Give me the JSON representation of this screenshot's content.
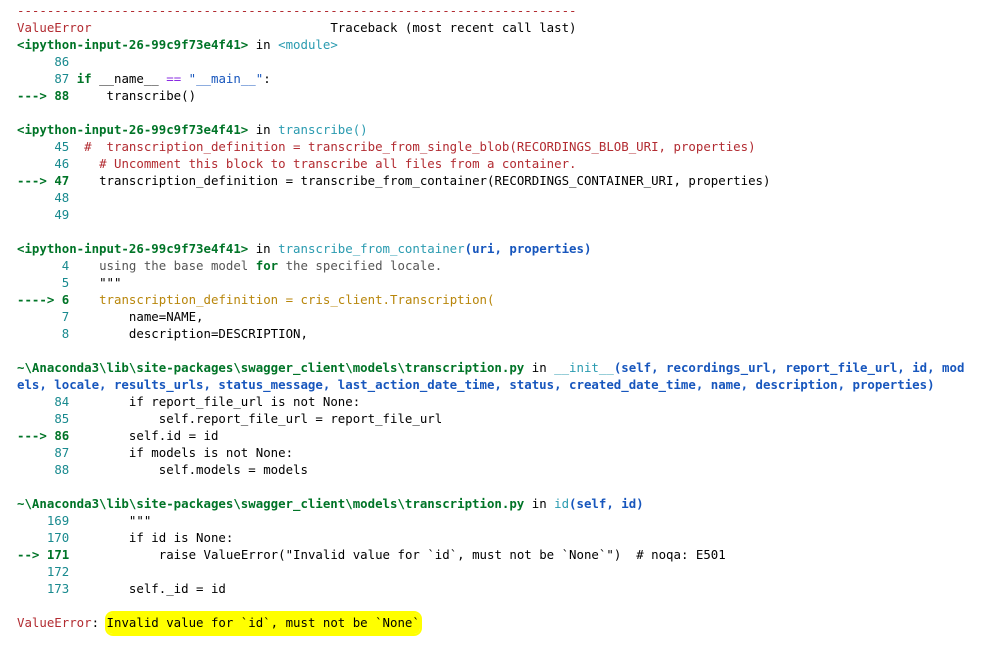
{
  "traceback": {
    "separator": "---------------------------------------------------------------------------",
    "header_error": "ValueError",
    "header_right": "Traceback (most recent call last)",
    "frames": [
      {
        "file": "<ipython-input-26-99c9f73e4f41>",
        "in": " in ",
        "func": "<module>",
        "lines": [
          {
            "arrow": "",
            "num": "86",
            "code": ""
          },
          {
            "arrow": "",
            "num": "87",
            "code": "if __name__ == \"__main__\":"
          },
          {
            "arrow": "--->",
            "num": "88",
            "code": "    transcribe()"
          }
        ]
      },
      {
        "file": "<ipython-input-26-99c9f73e4f41>",
        "in": " in ",
        "func": "transcribe()",
        "lines": [
          {
            "arrow": "",
            "num": "45",
            "code": "#  transcription_definition = transcribe_from_single_blob(RECORDINGS_BLOB_URI, properties)"
          },
          {
            "arrow": "",
            "num": "46",
            "code": "    # Uncomment this block to transcribe all files from a container."
          },
          {
            "arrow": "--->",
            "num": "47",
            "code": "    transcription_definition = transcribe_from_container(RECORDINGS_CONTAINER_URI, properties)"
          },
          {
            "arrow": "",
            "num": "48",
            "code": ""
          },
          {
            "arrow": "",
            "num": "49",
            "code": ""
          }
        ]
      },
      {
        "file": "<ipython-input-26-99c9f73e4f41>",
        "in": " in ",
        "func": "transcribe_from_container",
        "args": "(uri, properties)",
        "lines": [
          {
            "arrow": "",
            "num": "4",
            "code": "    using the base model for the specified locale."
          },
          {
            "arrow": "",
            "num": "5",
            "code": "    \"\"\""
          },
          {
            "arrow": "---->",
            "num": "6",
            "code": "    transcription_definition = cris_client.Transcription("
          },
          {
            "arrow": "",
            "num": "7",
            "code": "        name=NAME,"
          },
          {
            "arrow": "",
            "num": "8",
            "code": "        description=DESCRIPTION,"
          }
        ]
      },
      {
        "file": "~\\Anaconda3\\lib\\site-packages\\swagger_client\\models\\transcription.py",
        "in": " in ",
        "func": "__init__",
        "args_line1": "(self, recordings_url, report_file_url, id, mod",
        "args_line2": "els, locale, results_urls, status_message, last_action_date_time, status, created_date_time, name, description, properties)",
        "lines": [
          {
            "arrow": "",
            "num": "84",
            "code": "        if report_file_url is not None:"
          },
          {
            "arrow": "",
            "num": "85",
            "code": "            self.report_file_url = report_file_url"
          },
          {
            "arrow": "--->",
            "num": "86",
            "code": "        self.id = id"
          },
          {
            "arrow": "",
            "num": "87",
            "code": "        if models is not None:"
          },
          {
            "arrow": "",
            "num": "88",
            "code": "            self.models = models"
          }
        ]
      },
      {
        "file": "~\\Anaconda3\\lib\\site-packages\\swagger_client\\models\\transcription.py",
        "in": " in ",
        "func": "id",
        "args": "(self, id)",
        "lines": [
          {
            "arrow": "",
            "num": "169",
            "code": "        \"\"\""
          },
          {
            "arrow": "",
            "num": "170",
            "code": "        if id is None:"
          },
          {
            "arrow": "-->",
            "num": "171",
            "code": "            raise ValueError(\"Invalid value for `id`, must not be `None`\")  # noqa: E501"
          },
          {
            "arrow": "",
            "num": "172",
            "code": ""
          },
          {
            "arrow": "",
            "num": "173",
            "code": "        self._id = id"
          }
        ]
      }
    ],
    "final_error_type": "ValueError",
    "final_error_colon": ": ",
    "final_error_message": "Invalid value for `id`, must not be `None`",
    "highlight_color": "#ffff00"
  }
}
